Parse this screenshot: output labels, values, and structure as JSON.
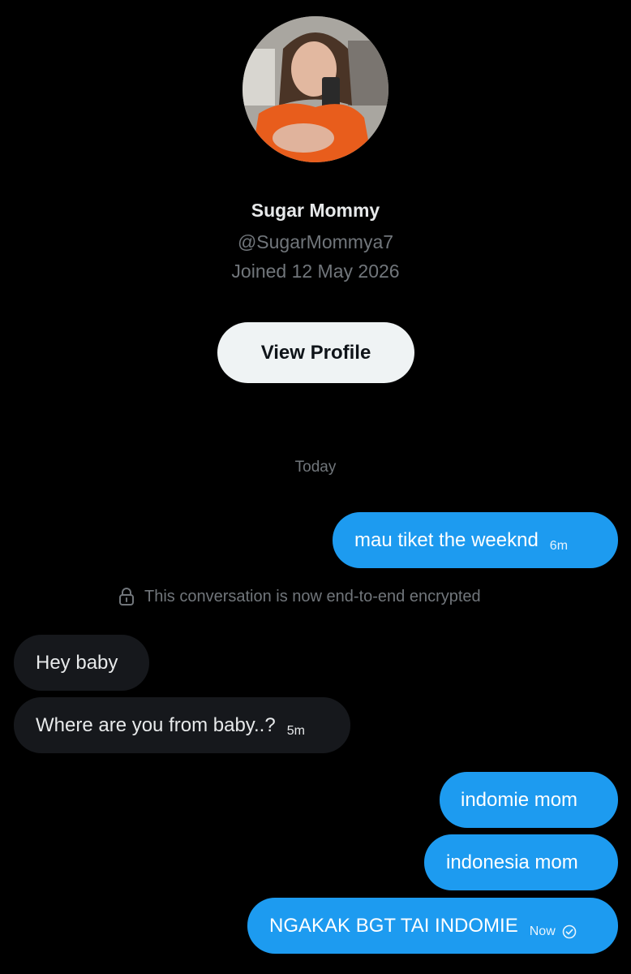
{
  "profile": {
    "name": "Sugar Mommy",
    "handle": "@SugarMommya7",
    "joined": "Joined 12 May 2026",
    "view_button": "View Profile"
  },
  "conversation": {
    "day_separator": "Today",
    "encryption_notice": "This conversation is now end-to-end encrypted",
    "messages": [
      {
        "direction": "outgoing",
        "text": "mau tiket the weeknd",
        "time": "6m"
      },
      {
        "direction": "incoming",
        "text": "Hey baby",
        "time": ""
      },
      {
        "direction": "incoming",
        "text": "Where are you from baby..?",
        "time": "5m"
      },
      {
        "direction": "outgoing",
        "text": "indomie mom",
        "time": ""
      },
      {
        "direction": "outgoing",
        "text": "indonesia mom",
        "time": ""
      },
      {
        "direction": "outgoing",
        "text": "NGAKAK BGT TAI INDOMIE",
        "time": "Now",
        "status_icon": "seen-check-icon"
      }
    ]
  },
  "colors": {
    "background": "#000000",
    "outgoing_bubble": "#1d9bf0",
    "incoming_bubble": "#16181c",
    "muted_text": "#71767b",
    "button_bg": "#eff3f4"
  }
}
